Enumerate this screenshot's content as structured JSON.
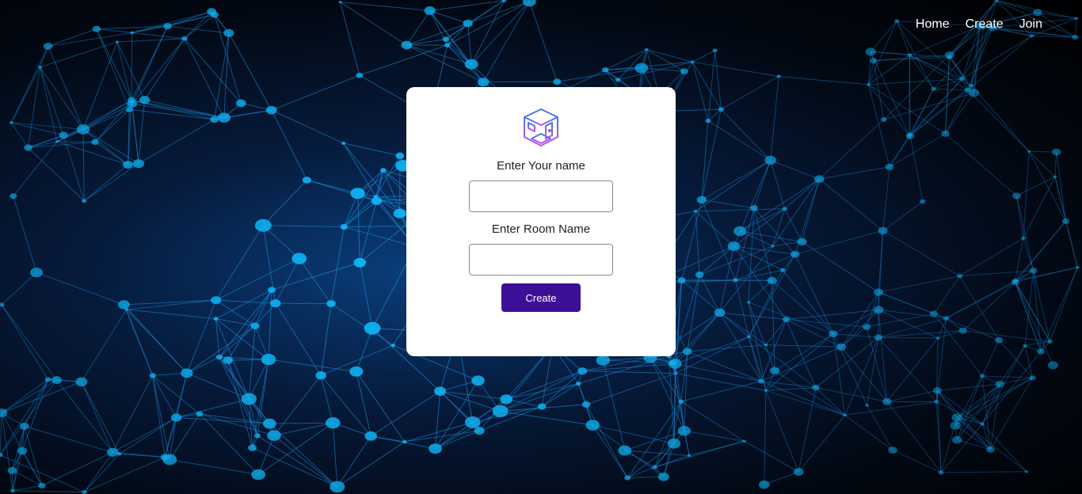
{
  "nav": {
    "home": "Home",
    "create": "Create",
    "join": "Join"
  },
  "form": {
    "name_label": "Enter Your name",
    "name_value": "",
    "room_label": "Enter Room Name",
    "room_value": "",
    "submit_label": "Create"
  },
  "colors": {
    "button": "#3c1096",
    "node": "#0fb4f5",
    "line": "#1680c9"
  },
  "icons": {
    "logo": "room-cube-icon"
  }
}
